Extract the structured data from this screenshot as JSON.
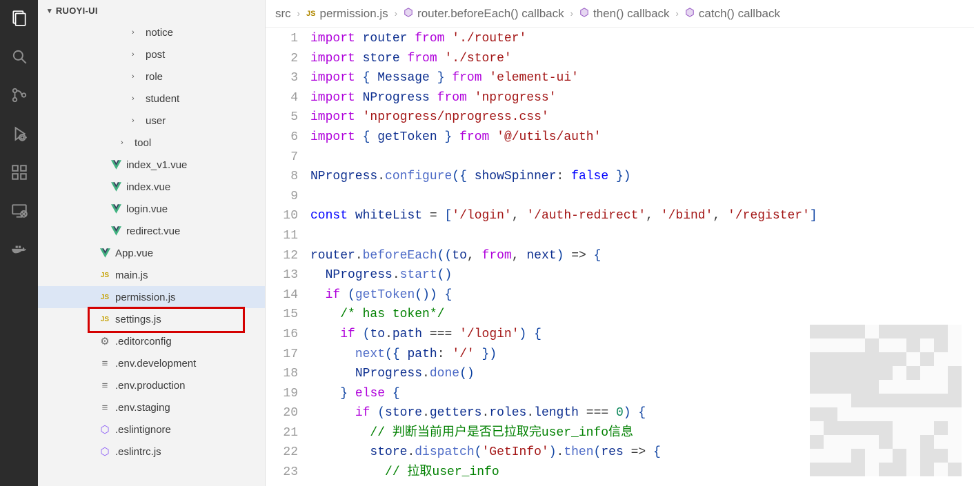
{
  "sidebar": {
    "title": "RUOYI-UI",
    "items": [
      {
        "name": "notice",
        "type": "folder",
        "indent": "indent-2"
      },
      {
        "name": "post",
        "type": "folder",
        "indent": "indent-2"
      },
      {
        "name": "role",
        "type": "folder",
        "indent": "indent-2"
      },
      {
        "name": "student",
        "type": "folder",
        "indent": "indent-2"
      },
      {
        "name": "user",
        "type": "folder",
        "indent": "indent-2"
      },
      {
        "name": "tool",
        "type": "folder",
        "indent": "indent-tool"
      },
      {
        "name": "index_v1.vue",
        "type": "vue",
        "indent": "indent-vue"
      },
      {
        "name": "index.vue",
        "type": "vue",
        "indent": "indent-vue"
      },
      {
        "name": "login.vue",
        "type": "vue",
        "indent": "indent-vue"
      },
      {
        "name": "redirect.vue",
        "type": "vue",
        "indent": "indent-vue"
      },
      {
        "name": "App.vue",
        "type": "vue",
        "indent": "indent-root"
      },
      {
        "name": "main.js",
        "type": "js",
        "indent": "indent-root"
      },
      {
        "name": "permission.js",
        "type": "js",
        "indent": "indent-root",
        "selected": true
      },
      {
        "name": "settings.js",
        "type": "js",
        "indent": "indent-root"
      },
      {
        "name": ".editorconfig",
        "type": "cfg-gear",
        "indent": "indent-root"
      },
      {
        "name": ".env.development",
        "type": "cfg",
        "indent": "indent-root"
      },
      {
        "name": ".env.production",
        "type": "cfg",
        "indent": "indent-root"
      },
      {
        "name": ".env.staging",
        "type": "cfg",
        "indent": "indent-root"
      },
      {
        "name": ".eslintignore",
        "type": "eslint",
        "indent": "indent-root"
      },
      {
        "name": ".eslintrc.js",
        "type": "eslint",
        "indent": "indent-root"
      }
    ]
  },
  "breadcrumb": [
    {
      "label": "src",
      "icon": ""
    },
    {
      "label": "permission.js",
      "icon": "js"
    },
    {
      "label": "router.beforeEach() callback",
      "icon": "mod"
    },
    {
      "label": "then() callback",
      "icon": "mod"
    },
    {
      "label": "catch() callback",
      "icon": "mod"
    }
  ],
  "code": {
    "startLine": 1,
    "lines": [
      [
        [
          "kw",
          "import"
        ],
        [
          "sp",
          " "
        ],
        [
          "id",
          "router"
        ],
        [
          "sp",
          " "
        ],
        [
          "kw",
          "from"
        ],
        [
          "sp",
          " "
        ],
        [
          "str",
          "'./router'"
        ]
      ],
      [
        [
          "kw",
          "import"
        ],
        [
          "sp",
          " "
        ],
        [
          "id",
          "store"
        ],
        [
          "sp",
          " "
        ],
        [
          "kw",
          "from"
        ],
        [
          "sp",
          " "
        ],
        [
          "str",
          "'./store'"
        ]
      ],
      [
        [
          "kw",
          "import"
        ],
        [
          "sp",
          " "
        ],
        [
          "brace",
          "{"
        ],
        [
          "sp",
          " "
        ],
        [
          "id",
          "Message"
        ],
        [
          "sp",
          " "
        ],
        [
          "brace",
          "}"
        ],
        [
          "sp",
          " "
        ],
        [
          "kw",
          "from"
        ],
        [
          "sp",
          " "
        ],
        [
          "str",
          "'element-ui'"
        ]
      ],
      [
        [
          "kw",
          "import"
        ],
        [
          "sp",
          " "
        ],
        [
          "id",
          "NProgress"
        ],
        [
          "sp",
          " "
        ],
        [
          "kw",
          "from"
        ],
        [
          "sp",
          " "
        ],
        [
          "str",
          "'nprogress'"
        ]
      ],
      [
        [
          "kw",
          "import"
        ],
        [
          "sp",
          " "
        ],
        [
          "str",
          "'nprogress/nprogress.css'"
        ]
      ],
      [
        [
          "kw",
          "import"
        ],
        [
          "sp",
          " "
        ],
        [
          "brace",
          "{"
        ],
        [
          "sp",
          " "
        ],
        [
          "id",
          "getToken"
        ],
        [
          "sp",
          " "
        ],
        [
          "brace",
          "}"
        ],
        [
          "sp",
          " "
        ],
        [
          "kw",
          "from"
        ],
        [
          "sp",
          " "
        ],
        [
          "str",
          "'@/utils/auth'"
        ]
      ],
      [],
      [
        [
          "id",
          "NProgress"
        ],
        [
          "punc",
          "."
        ],
        [
          "fn",
          "configure"
        ],
        [
          "brace",
          "("
        ],
        [
          "brace",
          "{"
        ],
        [
          "sp",
          " "
        ],
        [
          "id",
          "showSpinner"
        ],
        [
          "punc",
          ":"
        ],
        [
          "sp",
          " "
        ],
        [
          "kw2",
          "false"
        ],
        [
          "sp",
          " "
        ],
        [
          "brace",
          "}"
        ],
        [
          "brace",
          ")"
        ]
      ],
      [],
      [
        [
          "kw2",
          "const"
        ],
        [
          "sp",
          " "
        ],
        [
          "id",
          "whiteList"
        ],
        [
          "sp",
          " "
        ],
        [
          "punc",
          "="
        ],
        [
          "sp",
          " "
        ],
        [
          "brace",
          "["
        ],
        [
          "str",
          "'/login'"
        ],
        [
          "punc",
          ","
        ],
        [
          "sp",
          " "
        ],
        [
          "str",
          "'/auth-redirect'"
        ],
        [
          "punc",
          ","
        ],
        [
          "sp",
          " "
        ],
        [
          "str",
          "'/bind'"
        ],
        [
          "punc",
          ","
        ],
        [
          "sp",
          " "
        ],
        [
          "str",
          "'/register'"
        ],
        [
          "brace",
          "]"
        ]
      ],
      [],
      [
        [
          "id",
          "router"
        ],
        [
          "punc",
          "."
        ],
        [
          "fn",
          "beforeEach"
        ],
        [
          "brace",
          "("
        ],
        [
          "brace",
          "("
        ],
        [
          "id",
          "to"
        ],
        [
          "punc",
          ","
        ],
        [
          "sp",
          " "
        ],
        [
          "kw",
          "from"
        ],
        [
          "punc",
          ","
        ],
        [
          "sp",
          " "
        ],
        [
          "id",
          "next"
        ],
        [
          "brace",
          ")"
        ],
        [
          "sp",
          " "
        ],
        [
          "punc",
          "=>"
        ],
        [
          "sp",
          " "
        ],
        [
          "brace",
          "{"
        ]
      ],
      [
        [
          "sp",
          "  "
        ],
        [
          "id",
          "NProgress"
        ],
        [
          "punc",
          "."
        ],
        [
          "fn",
          "start"
        ],
        [
          "brace",
          "("
        ],
        [
          "brace",
          ")"
        ]
      ],
      [
        [
          "sp",
          "  "
        ],
        [
          "kw",
          "if"
        ],
        [
          "sp",
          " "
        ],
        [
          "brace",
          "("
        ],
        [
          "fn",
          "getToken"
        ],
        [
          "brace",
          "("
        ],
        [
          "brace",
          ")"
        ],
        [
          "brace",
          ")"
        ],
        [
          "sp",
          " "
        ],
        [
          "brace",
          "{"
        ]
      ],
      [
        [
          "sp",
          "    "
        ],
        [
          "comment",
          "/* has token*/"
        ]
      ],
      [
        [
          "sp",
          "    "
        ],
        [
          "kw",
          "if"
        ],
        [
          "sp",
          " "
        ],
        [
          "brace",
          "("
        ],
        [
          "id",
          "to"
        ],
        [
          "punc",
          "."
        ],
        [
          "id",
          "path"
        ],
        [
          "sp",
          " "
        ],
        [
          "punc",
          "==="
        ],
        [
          "sp",
          " "
        ],
        [
          "str",
          "'/login'"
        ],
        [
          "brace",
          ")"
        ],
        [
          "sp",
          " "
        ],
        [
          "brace",
          "{"
        ]
      ],
      [
        [
          "sp",
          "      "
        ],
        [
          "fn",
          "next"
        ],
        [
          "brace",
          "("
        ],
        [
          "brace",
          "{"
        ],
        [
          "sp",
          " "
        ],
        [
          "id",
          "path"
        ],
        [
          "punc",
          ":"
        ],
        [
          "sp",
          " "
        ],
        [
          "str",
          "'/'"
        ],
        [
          "sp",
          " "
        ],
        [
          "brace",
          "}"
        ],
        [
          "brace",
          ")"
        ]
      ],
      [
        [
          "sp",
          "      "
        ],
        [
          "id",
          "NProgress"
        ],
        [
          "punc",
          "."
        ],
        [
          "fn",
          "done"
        ],
        [
          "brace",
          "("
        ],
        [
          "brace",
          ")"
        ]
      ],
      [
        [
          "sp",
          "    "
        ],
        [
          "brace",
          "}"
        ],
        [
          "sp",
          " "
        ],
        [
          "kw",
          "else"
        ],
        [
          "sp",
          " "
        ],
        [
          "brace",
          "{"
        ]
      ],
      [
        [
          "sp",
          "      "
        ],
        [
          "kw",
          "if"
        ],
        [
          "sp",
          " "
        ],
        [
          "brace",
          "("
        ],
        [
          "id",
          "store"
        ],
        [
          "punc",
          "."
        ],
        [
          "id",
          "getters"
        ],
        [
          "punc",
          "."
        ],
        [
          "id",
          "roles"
        ],
        [
          "punc",
          "."
        ],
        [
          "id",
          "length"
        ],
        [
          "sp",
          " "
        ],
        [
          "punc",
          "==="
        ],
        [
          "sp",
          " "
        ],
        [
          "num",
          "0"
        ],
        [
          "brace",
          ")"
        ],
        [
          "sp",
          " "
        ],
        [
          "brace",
          "{"
        ]
      ],
      [
        [
          "sp",
          "        "
        ],
        [
          "comment",
          "// 判断当前用户是否已拉取完user_info信息"
        ]
      ],
      [
        [
          "sp",
          "        "
        ],
        [
          "id",
          "store"
        ],
        [
          "punc",
          "."
        ],
        [
          "fn",
          "dispatch"
        ],
        [
          "brace",
          "("
        ],
        [
          "str",
          "'GetInfo'"
        ],
        [
          "brace",
          ")"
        ],
        [
          "punc",
          "."
        ],
        [
          "fn",
          "then"
        ],
        [
          "brace",
          "("
        ],
        [
          "id",
          "res"
        ],
        [
          "sp",
          " "
        ],
        [
          "punc",
          "=>"
        ],
        [
          "sp",
          " "
        ],
        [
          "brace",
          "{"
        ]
      ],
      [
        [
          "sp",
          "          "
        ],
        [
          "comment",
          "// 拉取user_info"
        ]
      ]
    ]
  }
}
